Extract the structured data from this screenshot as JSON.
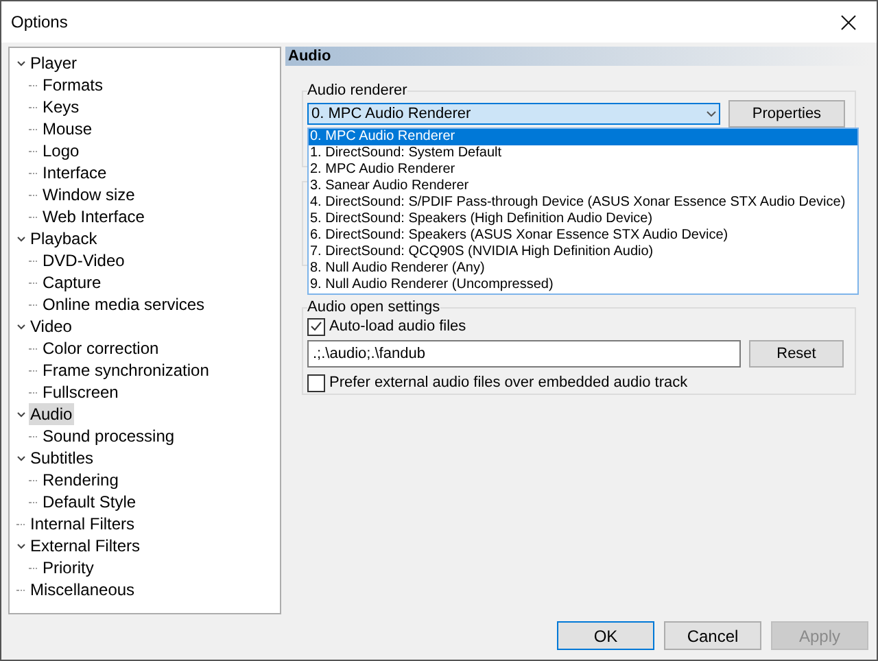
{
  "window": {
    "title": "Options"
  },
  "tree": [
    {
      "label": "Player",
      "selected": false,
      "expanded": true,
      "children": [
        {
          "label": "Formats",
          "selected": false
        },
        {
          "label": "Keys",
          "selected": false
        },
        {
          "label": "Mouse",
          "selected": false
        },
        {
          "label": "Logo",
          "selected": false
        },
        {
          "label": "Interface",
          "selected": false
        },
        {
          "label": "Window size",
          "selected": false
        },
        {
          "label": "Web Interface",
          "selected": false
        }
      ]
    },
    {
      "label": "Playback",
      "selected": false,
      "expanded": true,
      "children": [
        {
          "label": "DVD-Video",
          "selected": false
        },
        {
          "label": "Capture",
          "selected": false
        },
        {
          "label": "Online media services",
          "selected": false
        }
      ]
    },
    {
      "label": "Video",
      "selected": false,
      "expanded": true,
      "children": [
        {
          "label": "Color correction",
          "selected": false
        },
        {
          "label": "Frame synchronization",
          "selected": false
        },
        {
          "label": "Fullscreen",
          "selected": false
        }
      ]
    },
    {
      "label": "Audio",
      "selected": true,
      "expanded": true,
      "children": [
        {
          "label": "Sound processing",
          "selected": false
        }
      ]
    },
    {
      "label": "Subtitles",
      "selected": false,
      "expanded": true,
      "children": [
        {
          "label": "Rendering",
          "selected": false
        },
        {
          "label": "Default Style",
          "selected": false
        }
      ]
    },
    {
      "label": "Internal Filters",
      "selected": false
    },
    {
      "label": "External Filters",
      "selected": false,
      "expanded": true,
      "children": [
        {
          "label": "Priority",
          "selected": false
        }
      ]
    },
    {
      "label": "Miscellaneous",
      "selected": false
    }
  ],
  "page": {
    "header": "Audio",
    "renderer": {
      "group_title": "Audio renderer",
      "value": "0. MPC Audio Renderer",
      "properties_button": "Properties",
      "options": [
        {
          "label": "0. MPC Audio Renderer",
          "selected": true
        },
        {
          "label": "1. DirectSound: System Default",
          "selected": false
        },
        {
          "label": "2. MPC Audio Renderer",
          "selected": false
        },
        {
          "label": "3. Sanear Audio Renderer",
          "selected": false
        },
        {
          "label": "4. DirectSound: S/PDIF Pass-through Device (ASUS Xonar Essence STX Audio Device)",
          "selected": false
        },
        {
          "label": "5. DirectSound: Speakers (High Definition Audio Device)",
          "selected": false
        },
        {
          "label": "6. DirectSound: Speakers (ASUS Xonar Essence STX Audio Device)",
          "selected": false
        },
        {
          "label": "7. DirectSound: QCQ90S (NVIDIA High Definition Audio)",
          "selected": false
        },
        {
          "label": "8. Null Audio Renderer (Any)",
          "selected": false
        },
        {
          "label": "9. Null Audio Renderer (Uncompressed)",
          "selected": false
        }
      ]
    },
    "open_settings": {
      "group_title": "Audio open settings",
      "auto_load": {
        "label": "Auto-load audio files",
        "checked": true
      },
      "paths": ".;.\\audio;.\\fandub",
      "reset_button": "Reset",
      "prefer_external": {
        "label": "Prefer external audio files over embedded audio track",
        "checked": false
      }
    }
  },
  "buttons": [
    {
      "label": "OK",
      "disabled": false,
      "default": true
    },
    {
      "label": "Cancel",
      "disabled": false,
      "default": false
    },
    {
      "label": "Apply",
      "disabled": true,
      "default": false
    }
  ]
}
